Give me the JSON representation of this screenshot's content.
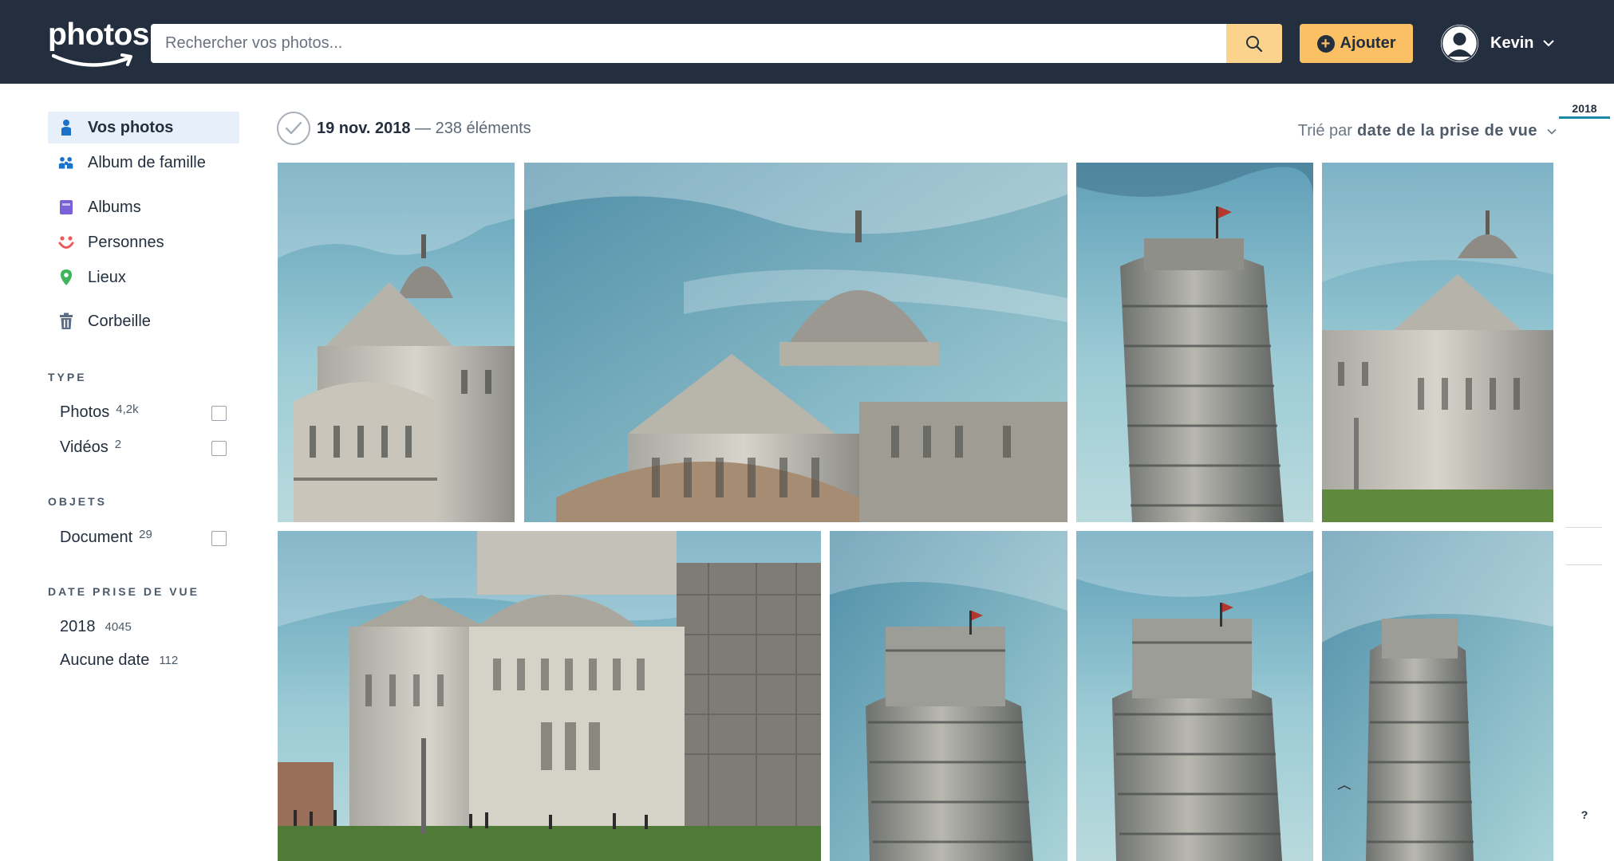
{
  "header": {
    "logo_text": "photos",
    "search_placeholder": "Rechercher vos photos...",
    "add_label": "Ajouter",
    "user_name": "Kevin"
  },
  "sidebar": {
    "nav": [
      {
        "label": "Vos photos",
        "icon": "person-icon",
        "active": true
      },
      {
        "label": "Album de famille",
        "icon": "family-icon"
      },
      {
        "label": "Albums",
        "icon": "album-icon"
      },
      {
        "label": "Personnes",
        "icon": "face-icon"
      },
      {
        "label": "Lieux",
        "icon": "location-pin-icon"
      },
      {
        "label": "Corbeille",
        "icon": "trash-icon"
      }
    ],
    "type": {
      "title": "TYPE",
      "items": [
        {
          "label": "Photos",
          "count": "4,2k"
        },
        {
          "label": "Vidéos",
          "count": "2"
        }
      ]
    },
    "objects": {
      "title": "OBJETS",
      "items": [
        {
          "label": "Document",
          "count": "29"
        }
      ]
    },
    "date": {
      "title": "DATE PRISE DE VUE",
      "items": [
        {
          "label": "2018",
          "count": "4045"
        },
        {
          "label": "Aucune date",
          "count": "112"
        }
      ]
    }
  },
  "main": {
    "date": "19 nov. 2018",
    "count_text": "— 238 éléments",
    "sort_prefix": "Trié par",
    "sort_value": "date de la prise de vue"
  },
  "timeline": {
    "year": "2018",
    "help": "?"
  },
  "colors": {
    "header_bg": "#232f3e",
    "accent_orange": "#fbc064",
    "search_btn": "#fbd38d",
    "active_nav_bg": "#e6effa",
    "timeline_accent": "#1d87a8"
  },
  "photos": [
    {
      "subject": "cathedral"
    },
    {
      "subject": "cathedral-dome"
    },
    {
      "subject": "leaning-tower"
    },
    {
      "subject": "cathedral"
    },
    {
      "subject": "cathedral-wide"
    },
    {
      "subject": "leaning-tower"
    },
    {
      "subject": "leaning-tower"
    },
    {
      "subject": "leaning-tower"
    }
  ]
}
